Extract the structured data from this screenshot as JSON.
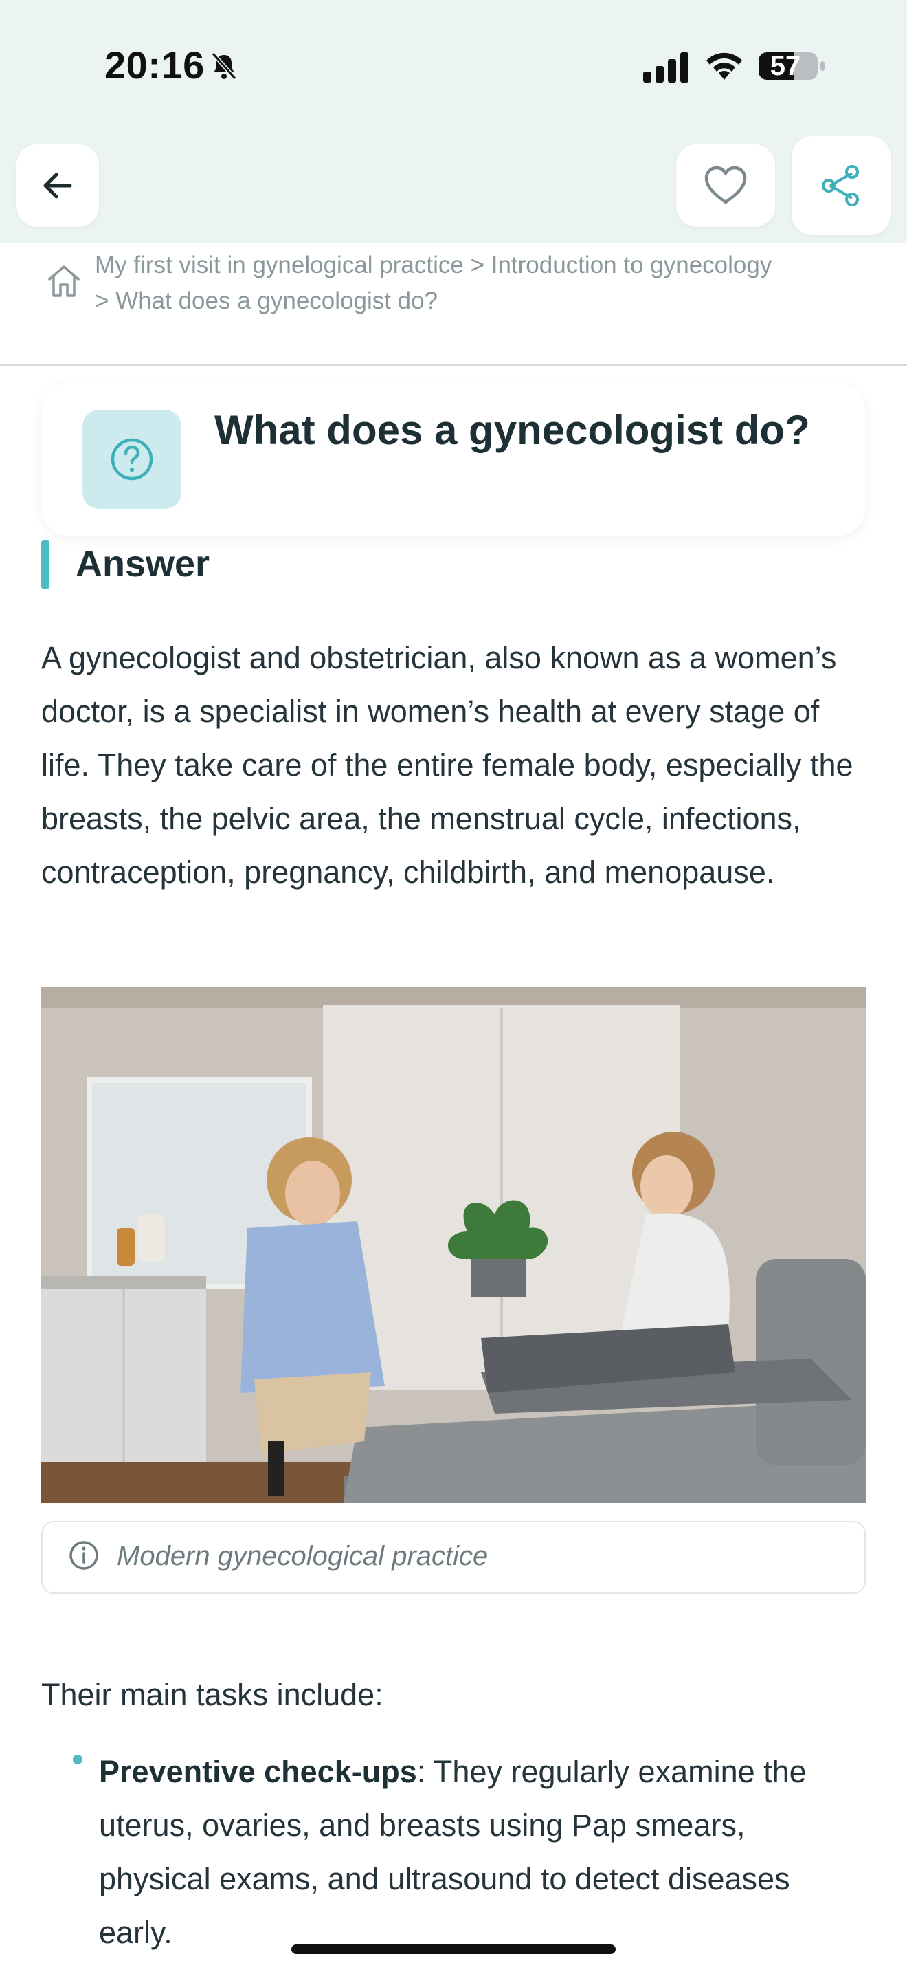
{
  "status_bar": {
    "time": "20:16",
    "battery": "57"
  },
  "breadcrumb": {
    "text": "My first visit in gynelogical practice > Introduction to gynecology > What does a gynecologist do?"
  },
  "article": {
    "title": "What does a gynecologist do?",
    "answer_label": "Answer",
    "paragraph": "A gynecologist and obstetrician, also known as a women’s doctor, is a specialist in women’s health at every stage of life. They take care of the entire female body, especially the breasts, the pelvic area, the menstrual cycle, infections, contraception, pregnancy, childbirth, and menopause.",
    "image_caption": "Modern gynecological practice",
    "tasks_intro": "Their main tasks include:",
    "tasks": [
      {
        "title": "Preventive check-ups",
        "text": ": They regularly examine the uterus, ovaries, and breasts using Pap smears, physical exams, and ultrasound to detect diseases early."
      }
    ]
  },
  "colors": {
    "accent": "#4bbcc4",
    "header_bg": "#ecf3f3",
    "badge_bg": "#cdebee"
  },
  "icons": [
    "back-arrow-icon",
    "heart-icon",
    "share-icon",
    "home-icon",
    "question-icon",
    "info-icon",
    "bell-slash-icon",
    "signal-icon",
    "wifi-icon",
    "battery-icon"
  ]
}
